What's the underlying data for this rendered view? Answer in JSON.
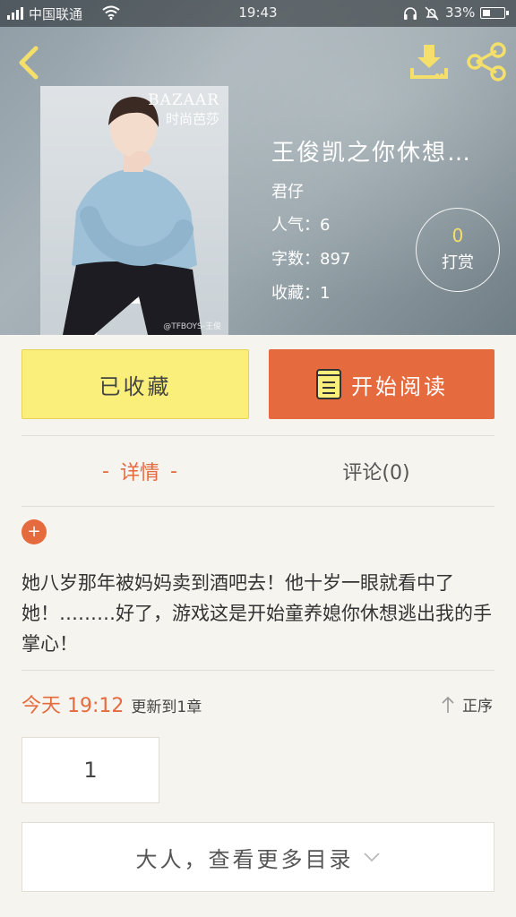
{
  "status_bar": {
    "carrier": "中国联通",
    "time": "19:43",
    "battery": "33%"
  },
  "book": {
    "title": "王俊凯之你休想…",
    "author": "君仔",
    "stats": [
      {
        "text": "人气：6"
      },
      {
        "text": "字数：897"
      },
      {
        "text": "收藏：1"
      }
    ],
    "cover": {
      "brand_line1": "BAZAAR",
      "brand_line2": "时尚芭莎",
      "watermark": "@TFBOYS-王俊"
    }
  },
  "reward": {
    "count": "0",
    "label": "打赏"
  },
  "actions": {
    "collected": "已收藏",
    "read": "开始阅读"
  },
  "tabs": [
    {
      "label": "详情",
      "dash": "-"
    },
    {
      "label": "评论(0)"
    }
  ],
  "expand_symbol": "+",
  "description": "她八岁那年被妈妈卖到酒吧去！他十岁一眼就看中了她！………好了，游戏这是开始童养媳你休想逃出我的手掌心！",
  "update": {
    "when": "今天 19:12",
    "info": "更新到1章"
  },
  "sort_label": "正序",
  "chapters": [
    "1"
  ],
  "more_catalog": "大人，查看更多目录",
  "colors": {
    "accent": "#e56a3d",
    "collected_bg": "#fbef7c",
    "icon_yellow": "#f4df6b"
  }
}
